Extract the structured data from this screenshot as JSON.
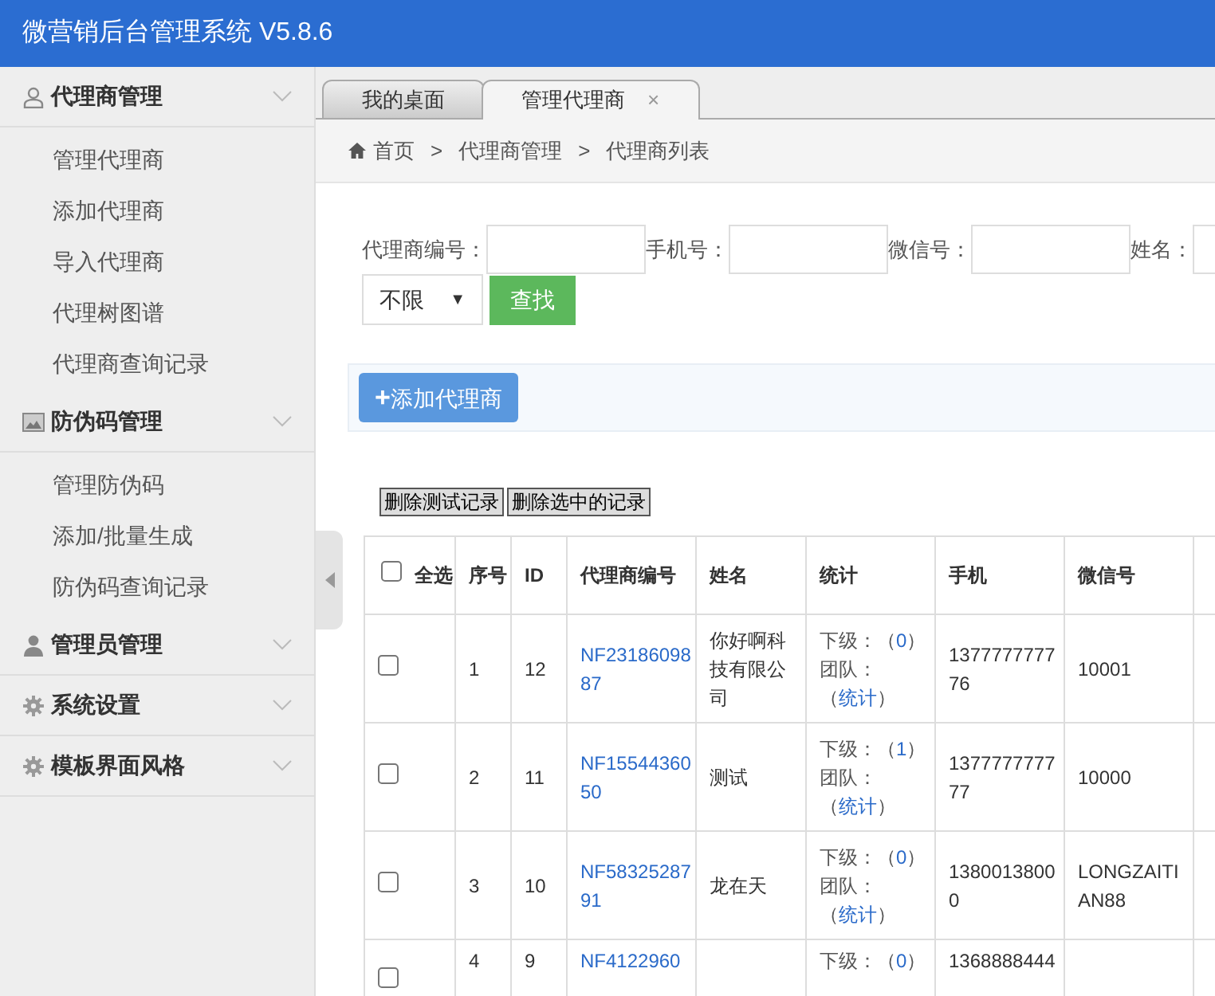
{
  "header": {
    "title": "微营销后台管理系统 V5.8.6"
  },
  "sidebar": {
    "groups": [
      {
        "title": "代理商管理",
        "items": [
          "管理代理商",
          "添加代理商",
          "导入代理商",
          "代理树图谱",
          "代理商查询记录"
        ]
      },
      {
        "title": "防伪码管理",
        "items": [
          "管理防伪码",
          "添加/批量生成",
          "防伪码查询记录"
        ]
      },
      {
        "title": "管理员管理"
      },
      {
        "title": "系统设置"
      },
      {
        "title": "模板界面风格"
      }
    ]
  },
  "tabs": [
    {
      "label": "我的桌面",
      "selected": false
    },
    {
      "label": "管理代理商",
      "selected": true,
      "close": "×"
    }
  ],
  "breadcrumb": [
    "首页",
    "代理商管理",
    "代理商列表"
  ],
  "breadcrumb_separator": ">",
  "filters": [
    {
      "label": "代理商编号："
    },
    {
      "label": "手机号："
    },
    {
      "label": "微信号："
    },
    {
      "label": "姓名："
    }
  ],
  "select": {
    "value": "不限",
    "arrow": "▼"
  },
  "search_button": "查找",
  "add_button": {
    "icon": "+",
    "label": "添加代理商"
  },
  "bulk_buttons": [
    "删除测试记录",
    "删除选中的记录"
  ],
  "table": {
    "select_all": "全选",
    "select_all_checked": false,
    "columns": [
      "序号",
      "ID",
      "代理商编号",
      "姓名",
      "统计",
      "手机",
      "微信号"
    ],
    "rows": [
      {
        "checked": false,
        "cells": [
          "1",
          "12",
          "NF2318609887",
          "你好啊科技有限公司",
          "",
          "137777777776",
          "10001"
        ],
        "stats": [
          "下级：（",
          "0",
          "）",
          "团队：（",
          "统计",
          "）"
        ]
      },
      {
        "checked": false,
        "cells": [
          "2",
          "11",
          "NF1554436050",
          "测试",
          "",
          "137777777777",
          "10000"
        ],
        "stats": [
          "下级：（",
          "1",
          "）",
          "团队：（",
          "统计",
          "）"
        ]
      },
      {
        "checked": false,
        "cells": [
          "3",
          "10",
          "NF5832528791",
          "龙在天",
          "",
          "13800138000",
          "LONGZAITIAN88"
        ],
        "stats": [
          "下级：（",
          "0",
          "）",
          "团队：（",
          "统计",
          "）"
        ]
      },
      {
        "checked": false,
        "cells": [
          "4",
          "9",
          "NF4122960",
          "",
          "",
          "1368888444",
          ""
        ],
        "stats": [
          "下级：（",
          "0",
          "）"
        ]
      }
    ]
  }
}
